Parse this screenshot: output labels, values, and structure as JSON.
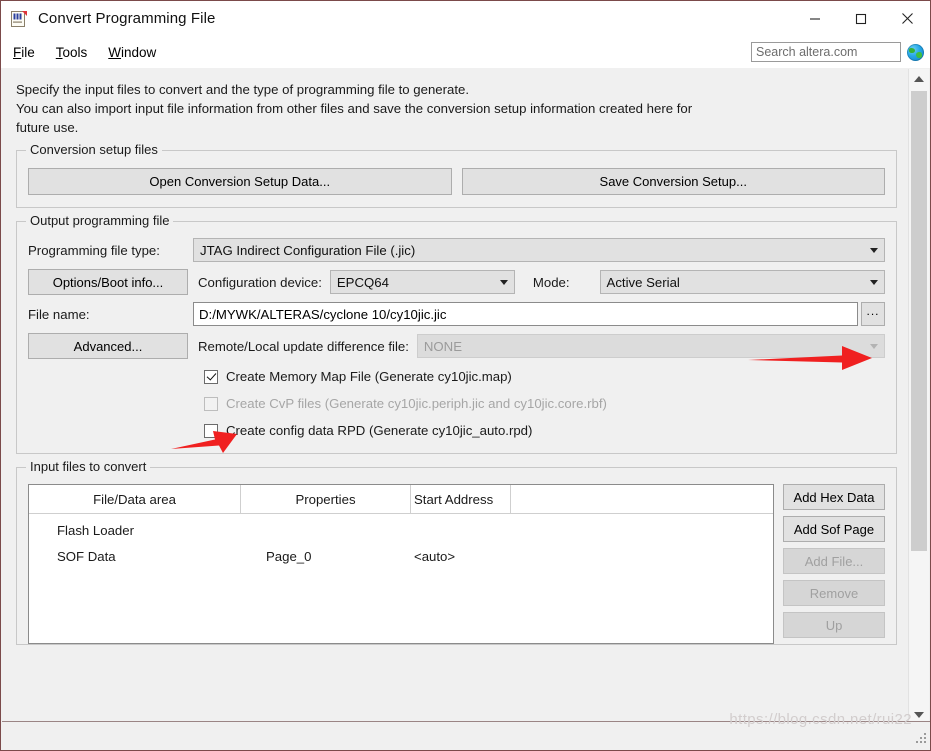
{
  "window": {
    "title": "Convert Programming File",
    "app_icon": "programming-file-icon",
    "minimize_label": "—",
    "maximize_label": "□",
    "close_label": "✕"
  },
  "menubar": {
    "items": [
      {
        "mnemonic": "F",
        "rest": "ile"
      },
      {
        "mnemonic": "T",
        "rest": "ools"
      },
      {
        "mnemonic": "W",
        "rest": "indow"
      }
    ]
  },
  "search": {
    "placeholder": "Search altera.com",
    "value": "",
    "icon": "globe-icon"
  },
  "intro": {
    "line1": "Specify the input files to convert and the type of programming file to generate.",
    "line2": "You can also import input file information from other files and save the conversion setup information created here for",
    "line3": "future use."
  },
  "conversion_setup": {
    "group_title": "Conversion setup files",
    "open_button": "Open Conversion Setup Data...",
    "save_button": "Save Conversion Setup..."
  },
  "output_file": {
    "group_title": "Output programming file",
    "file_type_label": "Programming file type:",
    "file_type_value": "JTAG Indirect Configuration File (.jic)",
    "options_boot_button": "Options/Boot info...",
    "config_device_label": "Configuration device:",
    "config_device_value": "EPCQ64",
    "mode_label": "Mode:",
    "mode_value": "Active Serial",
    "file_name_label": "File name:",
    "file_name_value": "D:/MYWK/ALTERAS/cyclone 10/cy10jic.jic",
    "browse_button": "...",
    "advanced_button": "Advanced...",
    "remote_local_label": "Remote/Local update difference file:",
    "remote_local_value": "NONE",
    "checkboxes": [
      {
        "label": "Create Memory Map File (Generate cy10jic.map)",
        "checked": true,
        "enabled": true
      },
      {
        "label": "Create CvP files (Generate cy10jic.periph.jic and cy10jic.core.rbf)",
        "checked": false,
        "enabled": false
      },
      {
        "label": "Create config data RPD (Generate cy10jic_auto.rpd)",
        "checked": false,
        "enabled": true
      }
    ]
  },
  "input_files": {
    "group_title": "Input files to convert",
    "columns": [
      "File/Data area",
      "Properties",
      "Start Address",
      ""
    ],
    "rows": [
      {
        "file_data_area": "Flash Loader",
        "properties": "",
        "start_address": "",
        "extra": ""
      },
      {
        "file_data_area": "SOF Data",
        "properties": "Page_0",
        "start_address": "<auto>",
        "extra": ""
      }
    ],
    "side_buttons": [
      {
        "label": "Add Hex Data",
        "enabled": true
      },
      {
        "label": "Add Sof Page",
        "enabled": true
      },
      {
        "label": "Add File...",
        "enabled": false
      },
      {
        "label": "Remove",
        "enabled": false
      },
      {
        "label": "Up",
        "enabled": false
      }
    ]
  },
  "scrollbar": {
    "up_arrow": "chevron-up",
    "down_arrow": "chevron-down"
  },
  "watermark": {
    "text": "https://blog.csdn.net/rui22"
  },
  "annotations": {
    "arrow_color": "#f02020",
    "arrow_browse_target": "browse-button",
    "arrow_memorymap_target": "create-memory-map-checkbox"
  }
}
